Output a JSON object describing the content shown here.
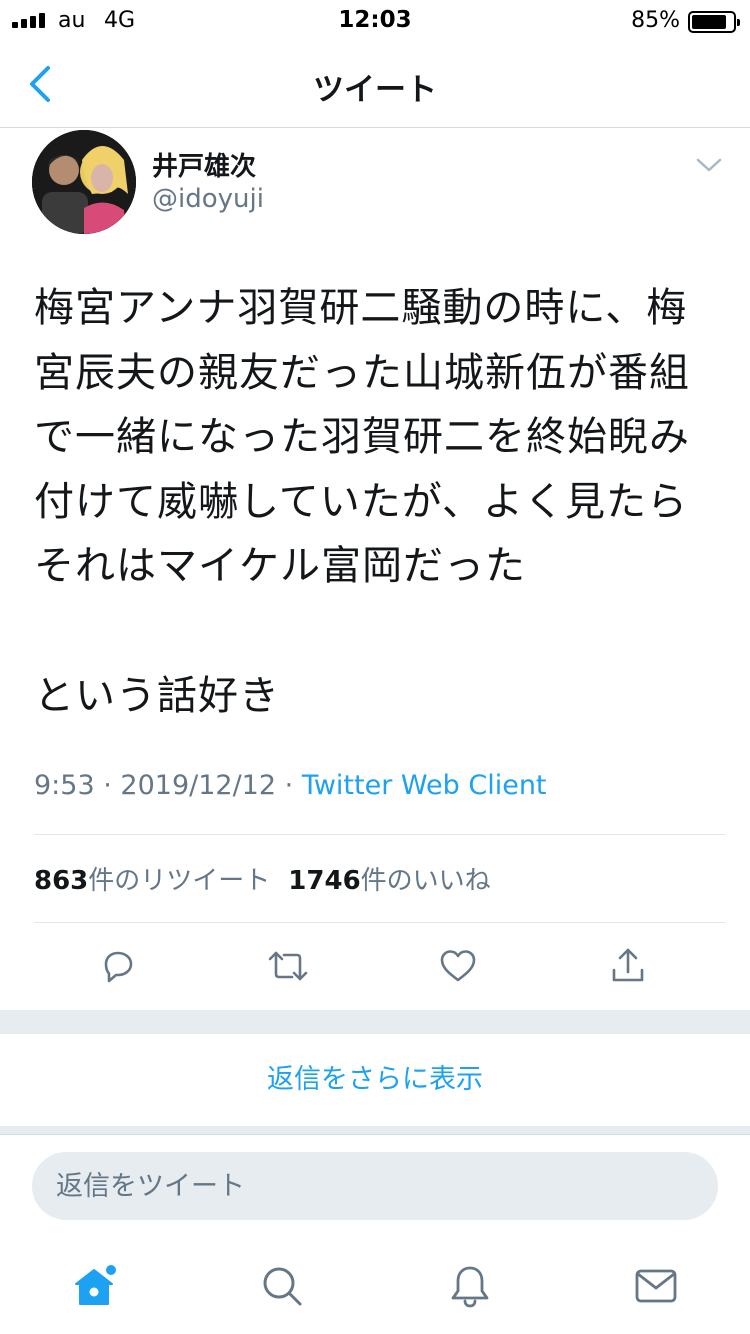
{
  "status_bar": {
    "carrier": "au",
    "network": "4G",
    "time": "12:03",
    "battery_percent_label": "85%",
    "battery_level": 0.85
  },
  "nav": {
    "back_icon": "chevron-left-icon",
    "title": "ツイート"
  },
  "tweet": {
    "display_name": "井戸雄次",
    "username": "@idoyuji",
    "text_paragraph_1": "梅宮アンナ羽賀研二騒動の時に、梅宮辰夫の親友だった山城新伍が番組で一緒になった羽賀研二を終始睨み付けて威嚇していたが、よく見たらそれはマイケル富岡だった",
    "text_paragraph_2": "という話好き",
    "time": "9:53",
    "separator": "·",
    "date": "2019/12/12",
    "source": "Twitter Web Client"
  },
  "stats": {
    "retweet_count": "863",
    "retweet_label": "件のリツイート",
    "like_count": "1746",
    "like_label": "件のいいね"
  },
  "actions": {
    "reply_icon": "reply-icon",
    "retweet_icon": "retweet-icon",
    "like_icon": "heart-icon",
    "share_icon": "share-icon"
  },
  "more_replies_label": "返信をさらに表示",
  "compose": {
    "placeholder": "返信をツイート",
    "value": ""
  },
  "tab_bar": {
    "items": [
      "home-icon",
      "search-icon",
      "notifications-icon",
      "messages-icon"
    ]
  },
  "colors": {
    "accent": "#1da1f2",
    "text": "#14171a",
    "secondary": "#657786",
    "separator": "#e6ecf0"
  }
}
